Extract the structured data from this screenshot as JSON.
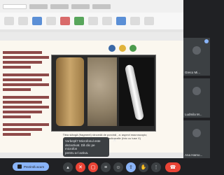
{
  "slide": {
    "caption_line1": "Tibia stângă (fragment) râncedă de porcină , a: aspect macroscopic;",
    "caption_line2": "b: aspect microcronoscopic; c: radiografie (foto cu tuse X)"
  },
  "participants": [
    {
      "name": "Greco Mi..."
    },
    {
      "name": "Ludmila M..."
    },
    {
      "name": "Ana Harno..."
    }
  ],
  "notification": {
    "line1": "Vorbeşti? Microfonul este",
    "line2": "dezactivat. Dă clic pe microfon",
    "line3": "pentru a-l activa.",
    "close": "×"
  },
  "controls": {
    "present_label": "Prezintă acum"
  }
}
